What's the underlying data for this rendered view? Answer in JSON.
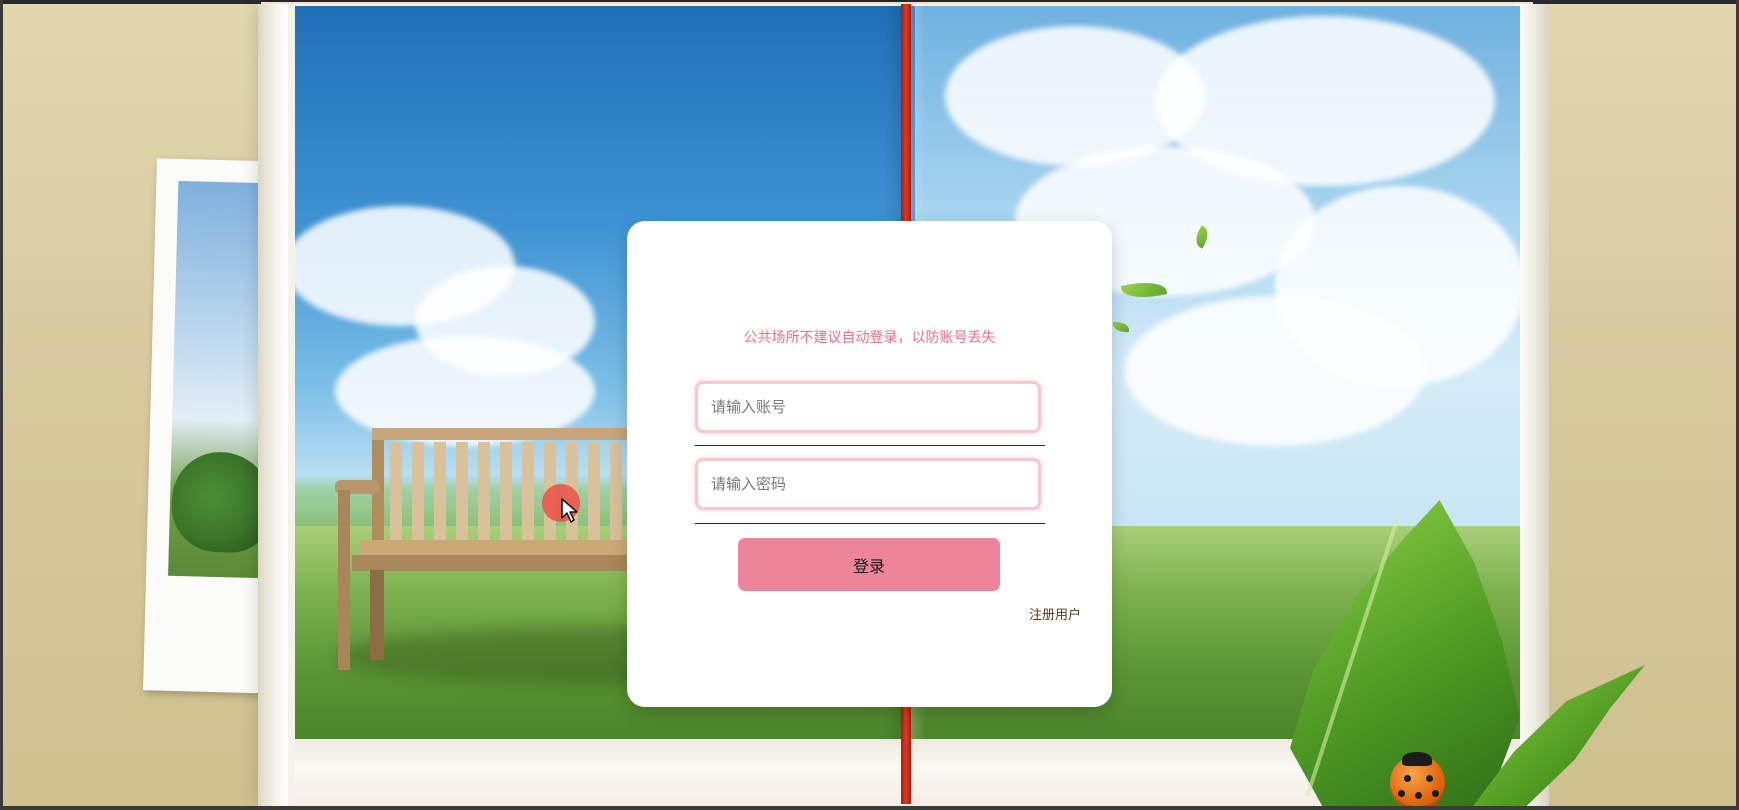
{
  "login": {
    "hint": "公共场所不建议自动登录，以防账号丢失",
    "username_placeholder": "请输入账号",
    "password_placeholder": "请输入密码",
    "login_button": "登录",
    "register_link": "注册用户"
  },
  "colors": {
    "accent": "#ee8499",
    "hint_text": "#ef6f85",
    "field_border": "#f7c7d0",
    "link_text": "#5a3a1a"
  },
  "decor": {
    "background_icons": [
      "bench-icon",
      "leaf-icon",
      "ladybug-icon",
      "tree-icon",
      "cloud-icon"
    ],
    "cursor_icon": "mouse-pointer-icon"
  }
}
